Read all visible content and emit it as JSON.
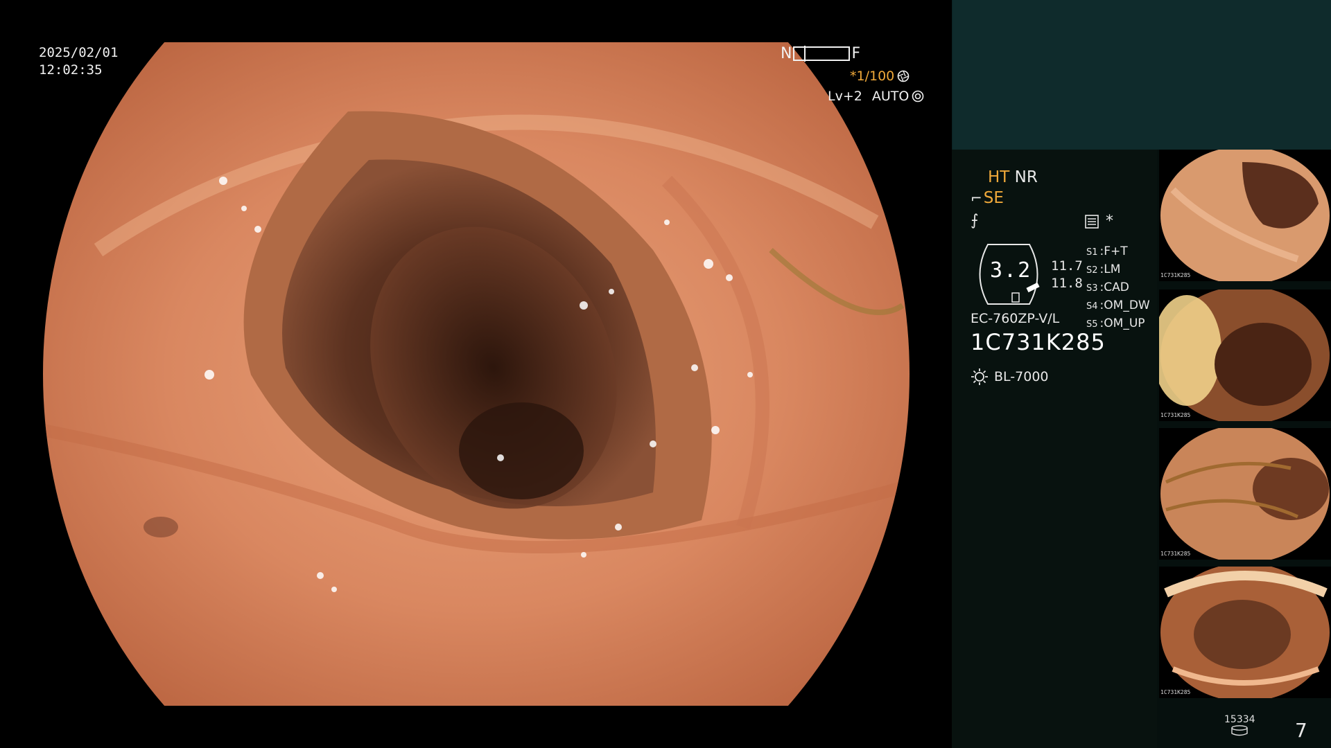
{
  "overlay": {
    "date": "2025/02/01",
    "time": "12:02:35",
    "near_label": "N",
    "far_label": "F",
    "shutter": "*1/100",
    "level": "Lv+2",
    "iris_mode": "AUTO"
  },
  "panel": {
    "ht": "HT",
    "nr": "NR",
    "se": "SE",
    "memo_star": "*",
    "zoom": "3.2",
    "values": [
      "11.7",
      "11.8"
    ],
    "switches": [
      {
        "key": "S1",
        "value": "F+T"
      },
      {
        "key": "S2",
        "value": "LM"
      },
      {
        "key": "S3",
        "value": "CAD"
      },
      {
        "key": "S4",
        "value": "OM_DW"
      },
      {
        "key": "S5",
        "value": "OM_UP"
      }
    ],
    "model": "EC-760ZP-V/L",
    "serial": "1C731K285",
    "light_source": "BL-7000",
    "counter": "15334",
    "page": "7"
  },
  "thumbnails": [
    {
      "caption": "1C731K285"
    },
    {
      "caption": "1C731K285"
    },
    {
      "caption": "1C731K285"
    },
    {
      "caption": "1C731K285"
    }
  ],
  "colors": {
    "accent_orange": "#f0a93a",
    "panel_top": "#0f2b2c",
    "panel_bg": "#08120f",
    "tissue": "#d9845d"
  }
}
